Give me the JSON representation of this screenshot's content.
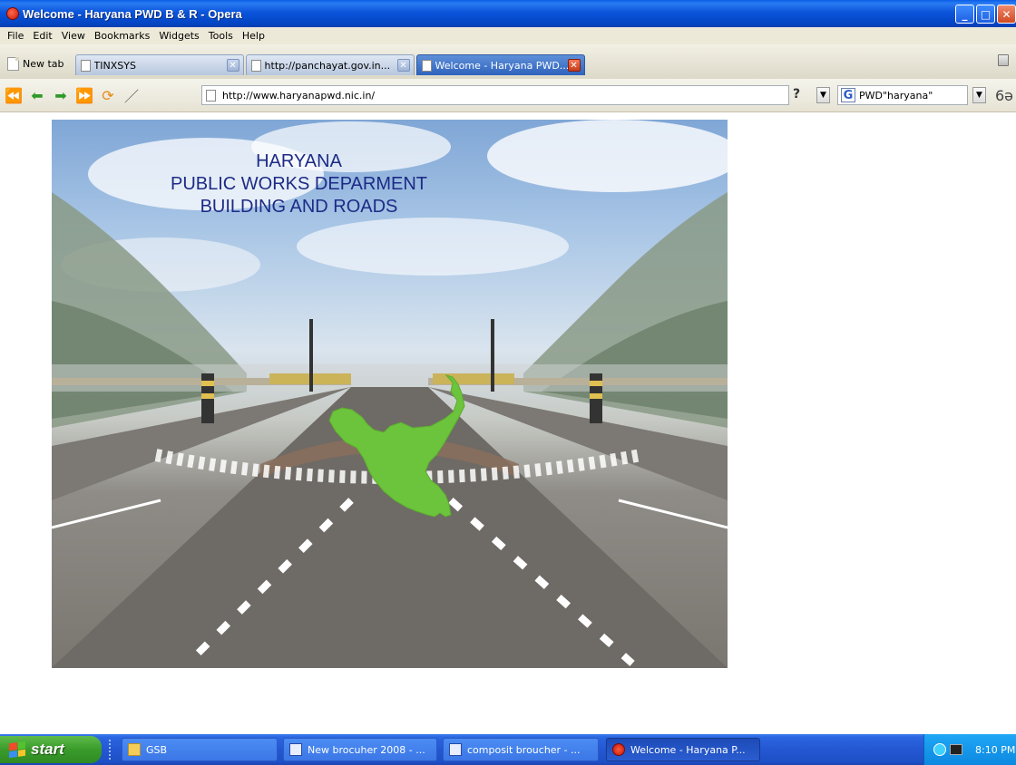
{
  "window": {
    "title": "Welcome - Haryana PWD B & R - Opera",
    "buttons": {
      "minimize": "_",
      "maximize": "□",
      "close": "✕"
    }
  },
  "menu": [
    "File",
    "Edit",
    "View",
    "Bookmarks",
    "Widgets",
    "Tools",
    "Help"
  ],
  "tabs": {
    "new_tab": "New tab",
    "items": [
      {
        "label": "TINXSYS",
        "active": false
      },
      {
        "label": "http://panchayat.gov.in...",
        "active": false
      },
      {
        "label": "Welcome - Haryana PWD...",
        "active": true
      }
    ]
  },
  "navbar": {
    "address": "http://www.haryanapwd.nic.in/",
    "help": "?",
    "search_engine_icon": "G",
    "search_value": "PWD\"haryana\""
  },
  "banner": {
    "line1": "HARYANA",
    "line2": "PUBLIC WORKS DEPARMENT",
    "line3": "BUILDING AND ROADS",
    "map_color": "#6cc33c"
  },
  "taskbar": {
    "start": "start",
    "items": [
      {
        "label": "GSB",
        "kind": "folder"
      },
      {
        "label": "New brocuher 2008 - ...",
        "kind": "word"
      },
      {
        "label": "composit broucher - ...",
        "kind": "word"
      },
      {
        "label": "Welcome - Haryana P...",
        "kind": "opera",
        "active": true
      }
    ],
    "clock": "8:10 PM"
  }
}
